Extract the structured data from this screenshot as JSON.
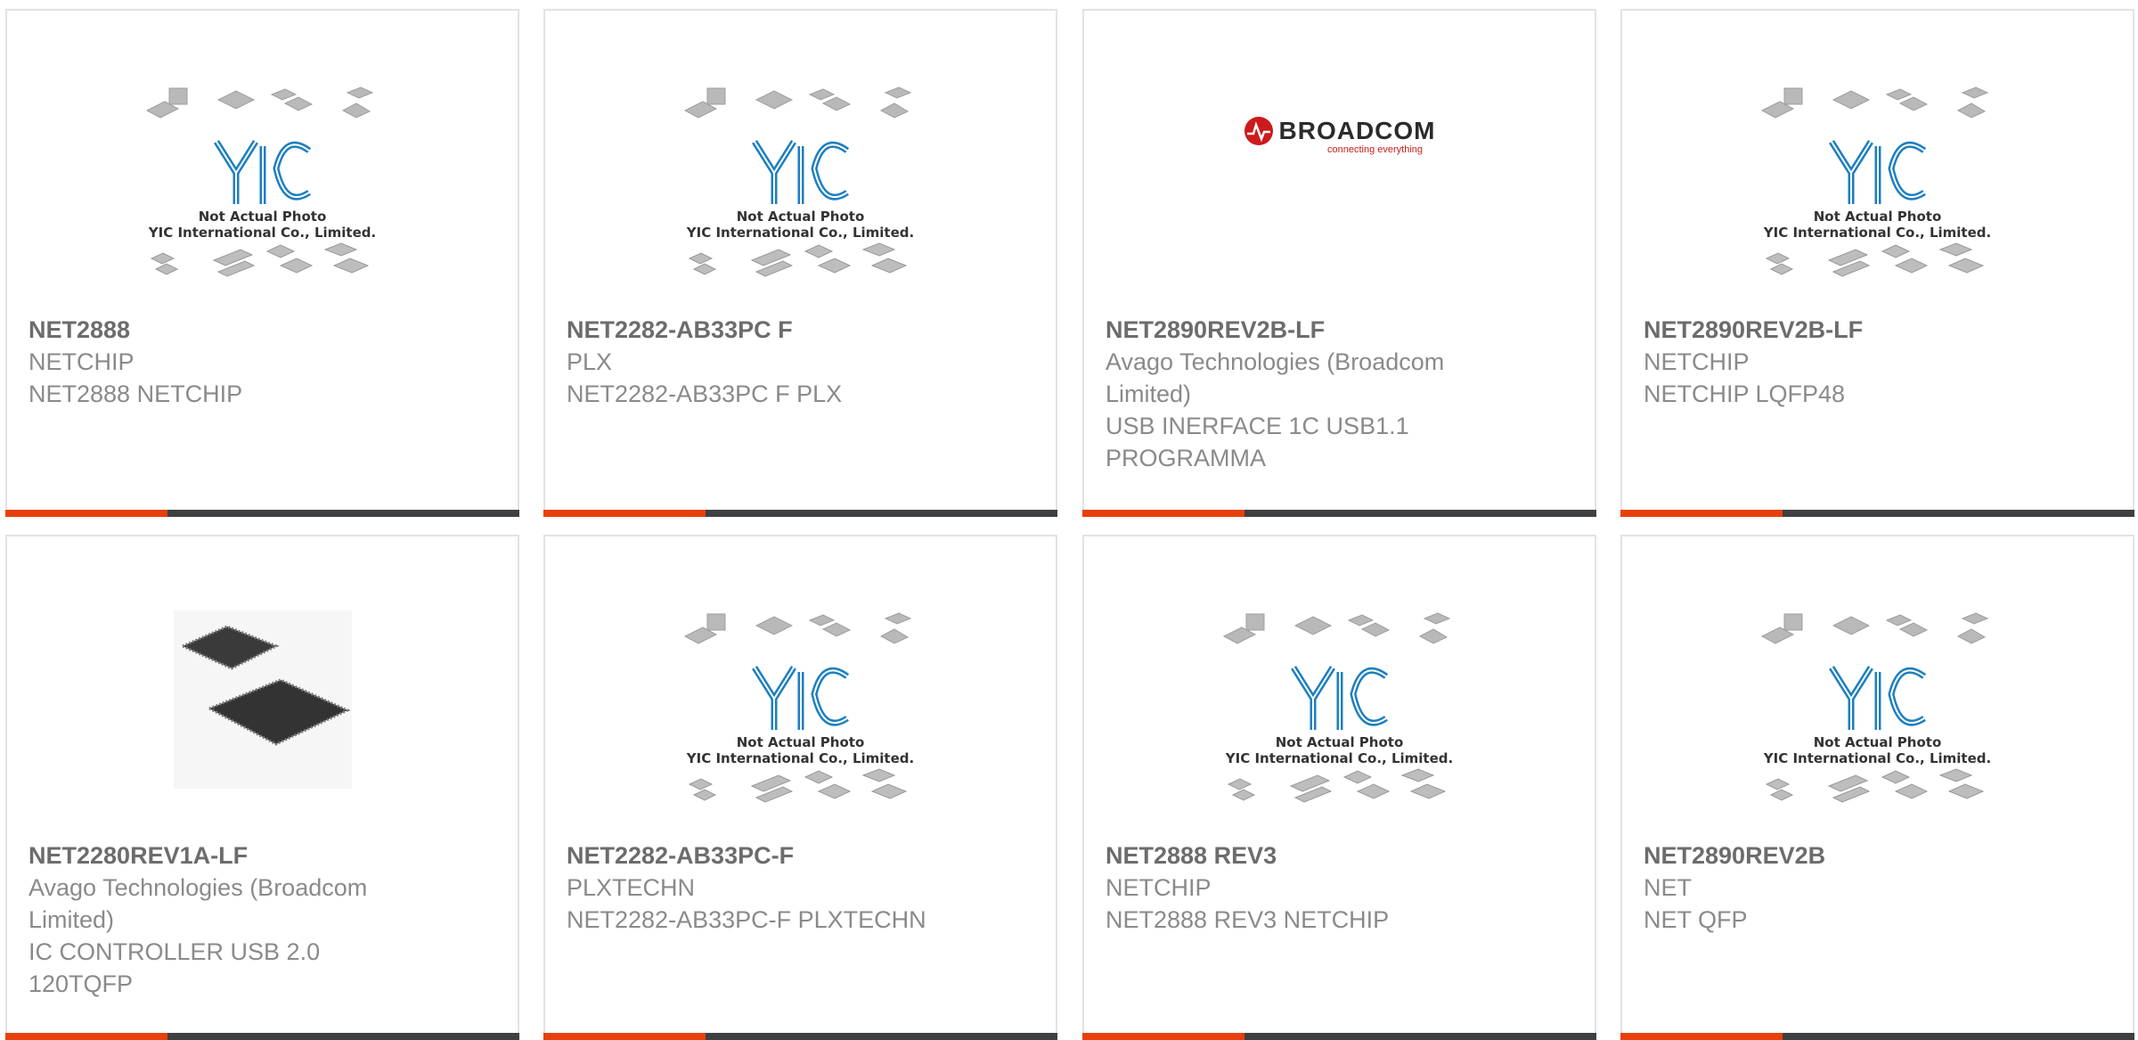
{
  "placeholder": {
    "line1": "Not Actual Photo",
    "line2": "YIC International Co., Limited.",
    "logo_text": "YIC"
  },
  "broadcom": {
    "name": "BROADCOM",
    "tagline": "connecting everything"
  },
  "colors": {
    "accent": "#e8400b",
    "bar": "#3d3f40",
    "yic_blue": "#1d7fbf"
  },
  "products": [
    {
      "part": "NET2888",
      "maker": "NETCHIP",
      "desc": "NET2888 NETCHIP",
      "image": "yic-placeholder"
    },
    {
      "part": "NET2282-AB33PC F",
      "maker": "PLX",
      "desc": "NET2282-AB33PC F PLX",
      "image": "yic-placeholder"
    },
    {
      "part": "NET2890REV2B-LF",
      "maker": "Avago Technologies (Broadcom Limited)",
      "desc": "USB INERFACE 1C USB1.1 PROGRAMMA",
      "image": "broadcom-logo"
    },
    {
      "part": "NET2890REV2B-LF",
      "maker": "NETCHIP",
      "desc": "NETCHIP LQFP48",
      "image": "yic-placeholder"
    },
    {
      "part": "NET2280REV1A-LF",
      "maker": "Avago Technologies (Broadcom Limited)",
      "desc": "IC CONTROLLER USB 2.0 120TQFP",
      "image": "tqfp-chip-photo"
    },
    {
      "part": "NET2282-AB33PC-F",
      "maker": "PLXTECHN",
      "desc": "NET2282-AB33PC-F PLXTECHN",
      "image": "yic-placeholder"
    },
    {
      "part": "NET2888 REV3",
      "maker": "NETCHIP",
      "desc": "NET2888 REV3 NETCHIP",
      "image": "yic-placeholder"
    },
    {
      "part": "NET2890REV2B",
      "maker": "NET",
      "desc": "NET QFP",
      "image": "yic-placeholder"
    }
  ]
}
